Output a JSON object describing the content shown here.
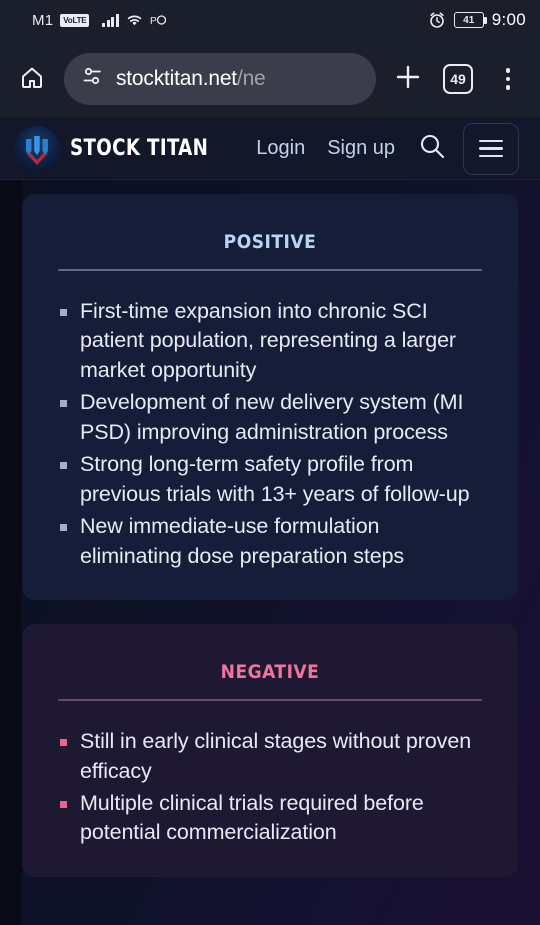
{
  "statusbar": {
    "carrier": "M1",
    "network_badge": "VoLTE",
    "signal_icon": "signal-bars-icon",
    "wifi_icon": "wifi-icon",
    "app_icon": "app-notification-icon",
    "alarm_icon": "alarm-clock-icon",
    "battery_level": "41",
    "time": "9:00"
  },
  "browser": {
    "home_icon": "home-icon",
    "page_info_icon": "page-settings-icon",
    "url_main": "stocktitan.net",
    "url_rest": "/ne",
    "new_tab_icon": "plus-icon",
    "tab_count": "49",
    "menu_icon": "three-dot-menu-icon"
  },
  "site_header": {
    "logo_icon": "stock-titan-logo-icon",
    "brand": "STOCK TITAN",
    "login_label": "Login",
    "signup_label": "Sign up",
    "search_icon": "search-icon",
    "menu_icon": "hamburger-menu-icon"
  },
  "cards": [
    {
      "title": "Positive",
      "accent": "#b9d5f5",
      "points": [
        "First-time expansion into chronic SCI patient population, representing a larger market opportunity",
        "Development of new delivery system (MI PSD) improving administration process",
        "Strong long-term safety profile from previous trials with 13+ years of follow-up",
        "New immediate-use formulation eliminating dose preparation steps"
      ]
    },
    {
      "title": "Negative",
      "accent": "#f2739c",
      "points": [
        "Still in early clinical stages without proven efficacy",
        "Multiple clinical trials required before potential commercialization"
      ]
    }
  ]
}
